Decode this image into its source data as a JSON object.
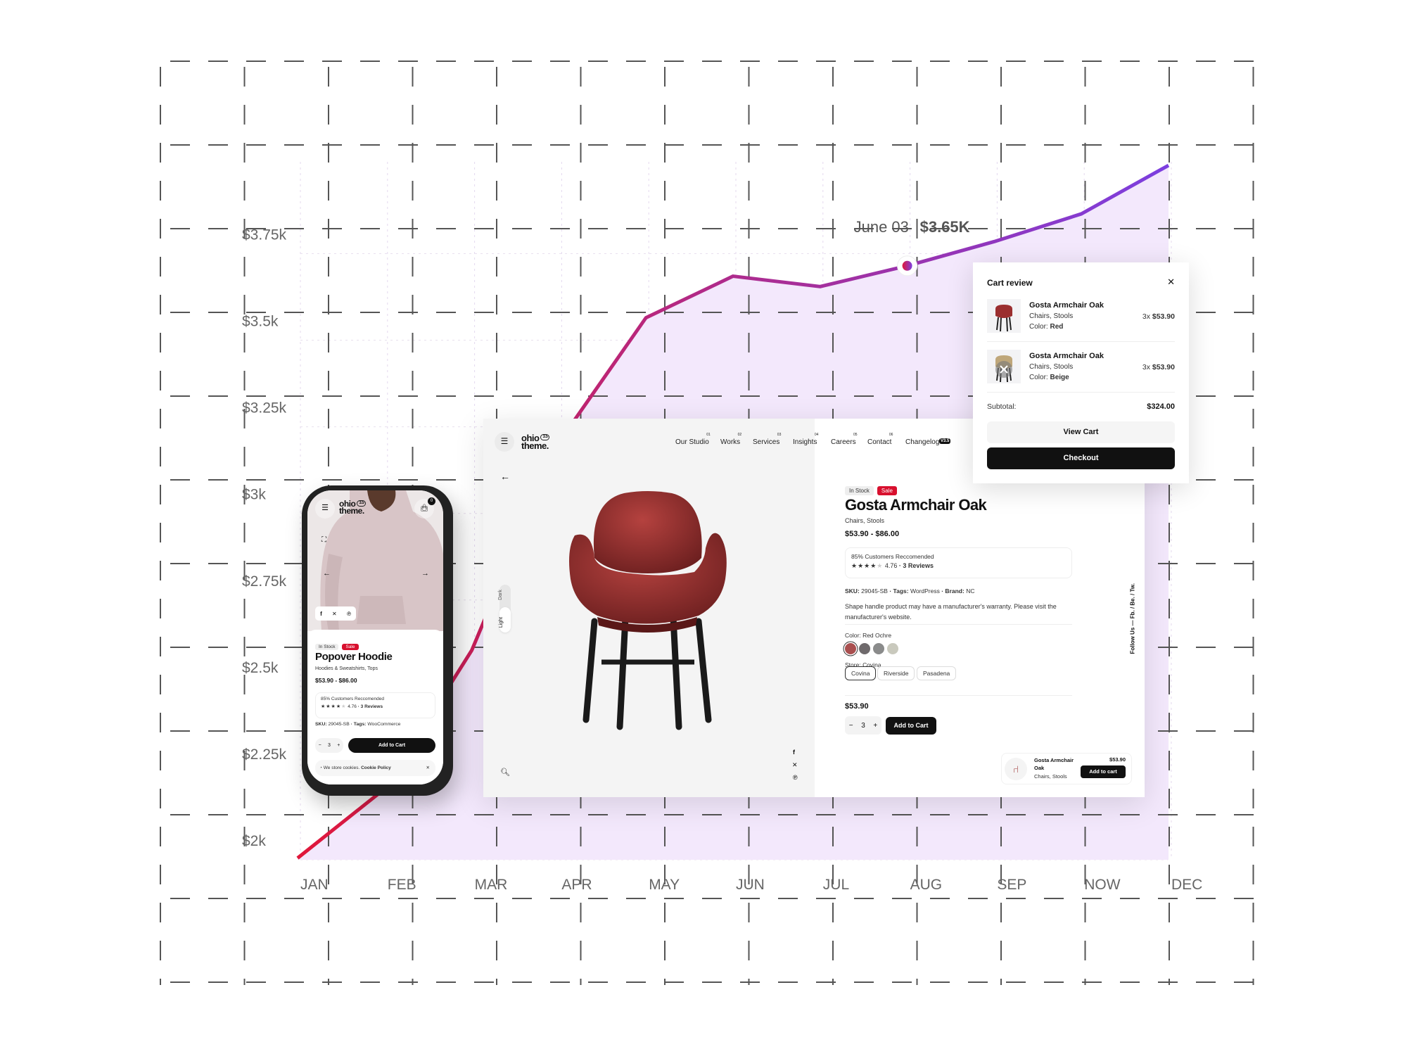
{
  "chart_data": {
    "type": "area",
    "categories": [
      "JAN",
      "FEB",
      "MAR",
      "APR",
      "MAY",
      "JUN",
      "JUL",
      "AUG",
      "SEP",
      "NOW",
      "DEC"
    ],
    "values": [
      1.95,
      2.15,
      2.55,
      3.15,
      3.51,
      3.63,
      3.6,
      3.66,
      3.73,
      3.81,
      3.95
    ],
    "unit": "$k",
    "y_ticks": [
      3.75,
      3.5,
      3.25,
      3,
      2.75,
      2.5,
      2.25,
      2
    ],
    "y_tick_labels": [
      "$3.75k",
      "$3.5k",
      "$3.25k",
      "$3k",
      "$2.75k",
      "$2.5k",
      "$2.25k",
      "$2k"
    ],
    "ylim": [
      1.9,
      4.0
    ],
    "grid": true,
    "tooltip": {
      "index": 7,
      "date": "June 03",
      "value": "$3.65K"
    },
    "colors": {
      "line_start": "#e0173a",
      "line_end": "#7c3fe0",
      "fill": "#f3e8fc",
      "grid": "#555555"
    }
  },
  "desktop": {
    "logo": {
      "line1": "ohio",
      "line2": "theme.",
      "version": "3.5"
    },
    "nav": [
      {
        "num": "01",
        "label": "Our Studio"
      },
      {
        "num": "02",
        "label": "Works"
      },
      {
        "num": "03",
        "label": "Services"
      },
      {
        "num": "04",
        "label": "Insights"
      },
      {
        "num": "05",
        "label": "Careers"
      },
      {
        "num": "06",
        "label": "Contact"
      },
      {
        "num": "",
        "label": "Changelog"
      }
    ],
    "changelog_badge": "V3.5",
    "theme_toggle": {
      "light": "Light",
      "dark": "Dark"
    },
    "product": {
      "badges": {
        "stock": "In Stock",
        "sale": "Sale"
      },
      "title": "Gosta Armchair Oak",
      "category": "Chairs, Stools",
      "price_range": "$53.90 - $86.00",
      "recommend": "85% Customers Reccomended",
      "rating": 4.76,
      "rating_text": "4.76",
      "reviews": "· 3 Reviews",
      "sku_label": "SKU:",
      "sku": "29045-SB",
      "tags_label": "· Tags:",
      "tags": "WordPress",
      "brand_label": "· Brand:",
      "brand": "NC",
      "description": "Shape handle product may have a manufacturer's warranty. Please visit the manufacturer's website.",
      "color_label": "Color:",
      "color_value": "Red Ochre",
      "swatches": [
        "#a94f4f",
        "#6f6a6c",
        "#8a8b8b",
        "#c9c9bd"
      ],
      "store_label": "Store:",
      "store_value": "Covina",
      "stores": [
        "Covina",
        "Riverside",
        "Pasadena"
      ],
      "price": "$53.90",
      "quantity": "3",
      "add_to_cart": "Add to Cart"
    },
    "follow": "Follow Us — Fb. / Be. / Tw.",
    "sticky": {
      "name": "Gosta Armchair Oak",
      "category": "Chairs, Stools",
      "price": "$53.90",
      "button": "Add to cart"
    }
  },
  "cart": {
    "title": "Cart review",
    "items": [
      {
        "name": "Gosta Armchair Oak",
        "category": "Chairs, Stools",
        "color_label": "Color:",
        "color": "Red",
        "qty_price": "3x",
        "price": "$53.90"
      },
      {
        "name": "Gosta Armchair Oak",
        "category": "Chairs, Stools",
        "color_label": "Color:",
        "color": "Beige",
        "qty_price": "3x",
        "price": "$53.90"
      }
    ],
    "subtotal_label": "Subtotal:",
    "subtotal": "$324.00",
    "view_cart": "View Cart",
    "checkout": "Checkout"
  },
  "phone": {
    "logo": {
      "line1": "ohio",
      "line2": "theme.",
      "version": "3.5"
    },
    "cart_count": "0",
    "badges": {
      "stock": "In Stock",
      "sale": "Sale"
    },
    "title": "Popover Hoodie",
    "category": "Hoodies & Sweatshirts, Tops",
    "price_range": "$53.90 - $86.00",
    "recommend": "85% Customers Reccomended",
    "rating_text": "4.76",
    "reviews": "· 3 Reviews",
    "sku_label": "SKU:",
    "sku": "29045-SB",
    "tags_label": "· Tags:",
    "tags": "WooCommerce",
    "quantity": "3",
    "add_to_cart": "Add to Cart",
    "cookie_text": "We store cookies.",
    "cookie_link": "Cookie Policy"
  }
}
